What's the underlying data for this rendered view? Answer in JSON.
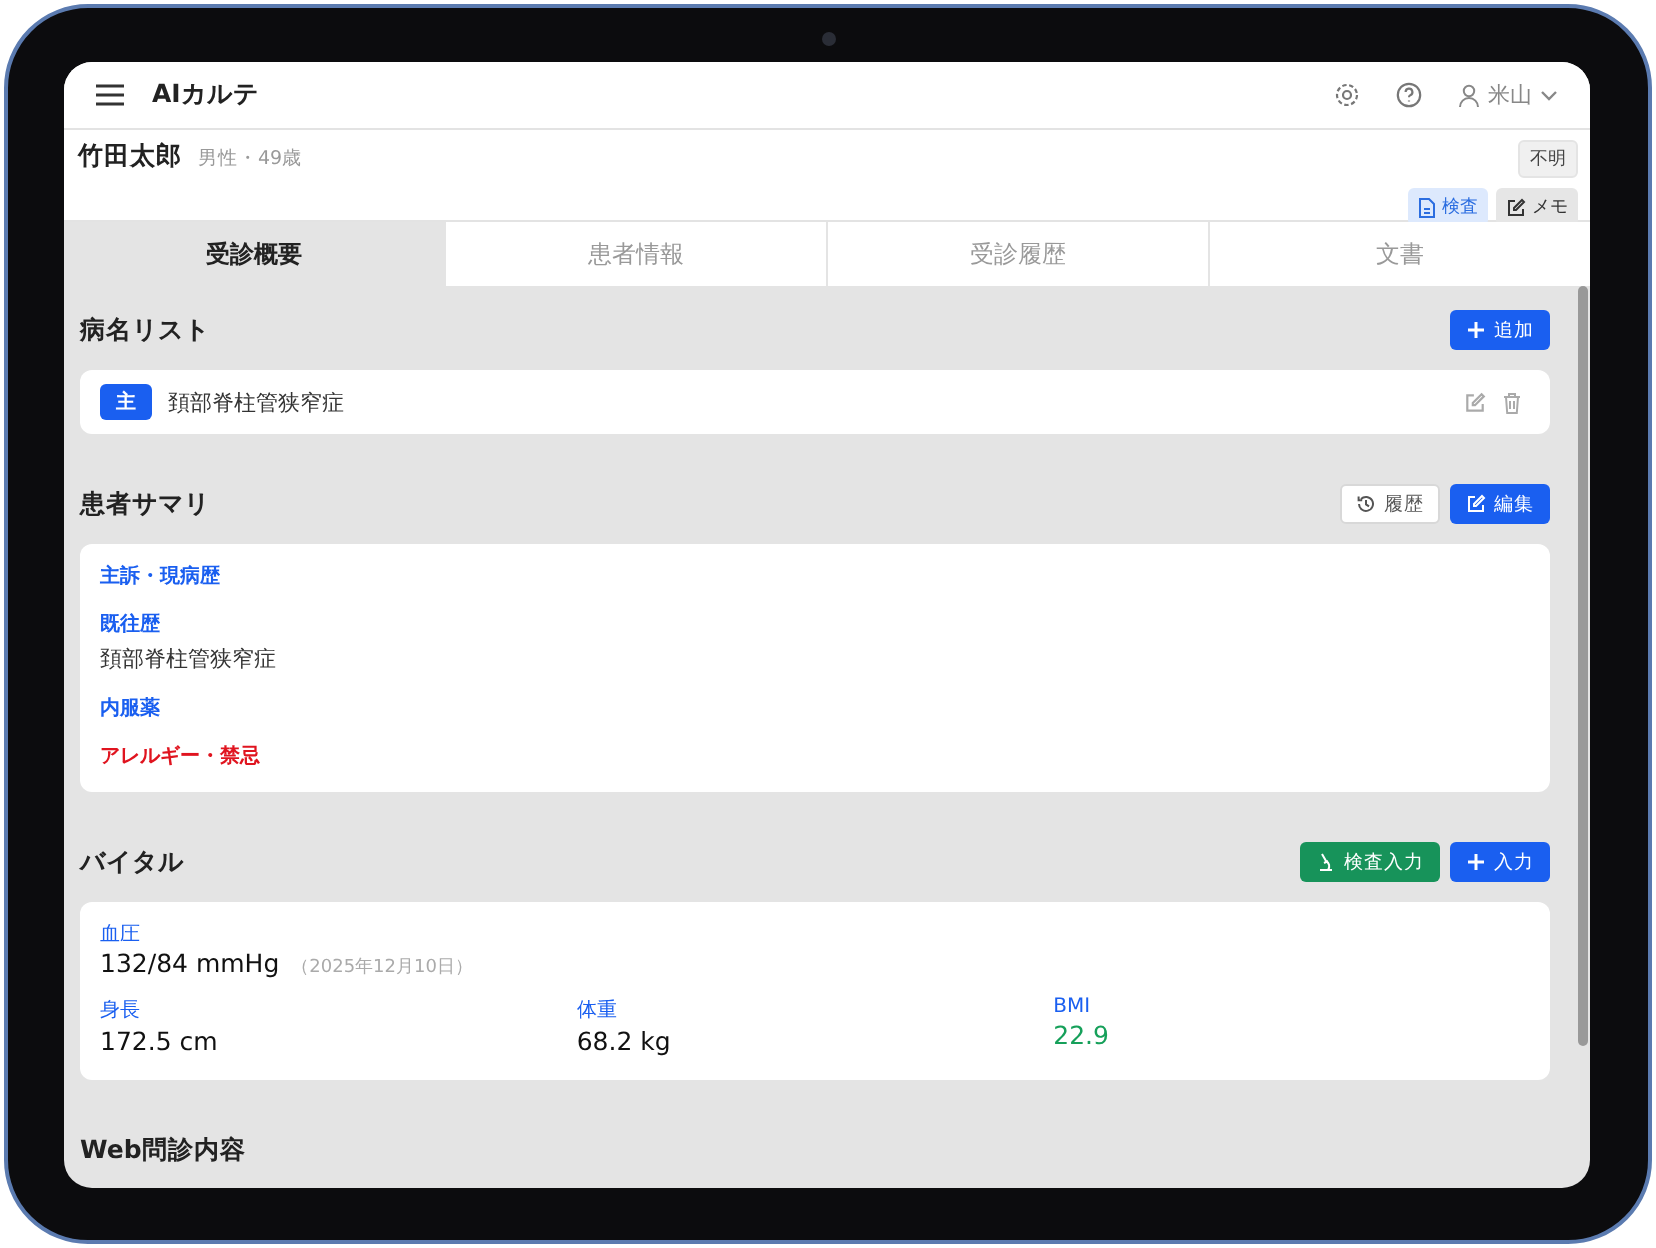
{
  "header": {
    "app_title": "AIカルテ",
    "user": "米山"
  },
  "patient": {
    "name": "竹田太郎",
    "meta": "男性・49歳",
    "status_badge": "不明",
    "buttons": [
      {
        "label": "検査",
        "kind": "exam"
      },
      {
        "label": "メモ",
        "kind": "memo"
      }
    ]
  },
  "tabs": [
    {
      "label": "受診概要",
      "selected": true
    },
    {
      "label": "患者情報",
      "selected": false
    },
    {
      "label": "受診履歴",
      "selected": false
    },
    {
      "label": "文書",
      "selected": false
    }
  ],
  "diagnoses": {
    "title": "病名リスト",
    "buttons": [
      {
        "label": "追加",
        "kind": "add"
      }
    ],
    "items": [
      {
        "tag": "主",
        "name": "頚部脊柱管狭窄症"
      }
    ]
  },
  "summary": {
    "title": "患者サマリ",
    "buttons": [
      {
        "label": "履歴",
        "kind": "history"
      },
      {
        "label": "編集",
        "kind": "edit"
      }
    ],
    "items": [
      {
        "label": "主訴・現病歴",
        "kind": "normal"
      },
      {
        "label": "既往歴",
        "kind": "normal",
        "value": "頚部脊柱管狭窄症"
      },
      {
        "label": "内服薬",
        "kind": "normal"
      },
      {
        "label": "アレルギー・禁忌",
        "kind": "alert"
      }
    ]
  },
  "vitals": {
    "title": "バイタル",
    "buttons": [
      {
        "label": "検査入力",
        "kind": "lab"
      },
      {
        "label": "入力",
        "kind": "add"
      }
    ],
    "blood_pressure": {
      "label": "血圧",
      "value": "132/84 mmHg",
      "date": "（2025年12月10日）"
    },
    "metrics": [
      {
        "label": "身長",
        "value": "172.5 cm",
        "color": "#111111"
      },
      {
        "label": "体重",
        "value": "68.2 kg",
        "color": "#111111"
      },
      {
        "label": "BMI",
        "value": "22.9",
        "color": "#16a05a"
      }
    ]
  },
  "web_interview": {
    "title": "Web問診内容"
  }
}
